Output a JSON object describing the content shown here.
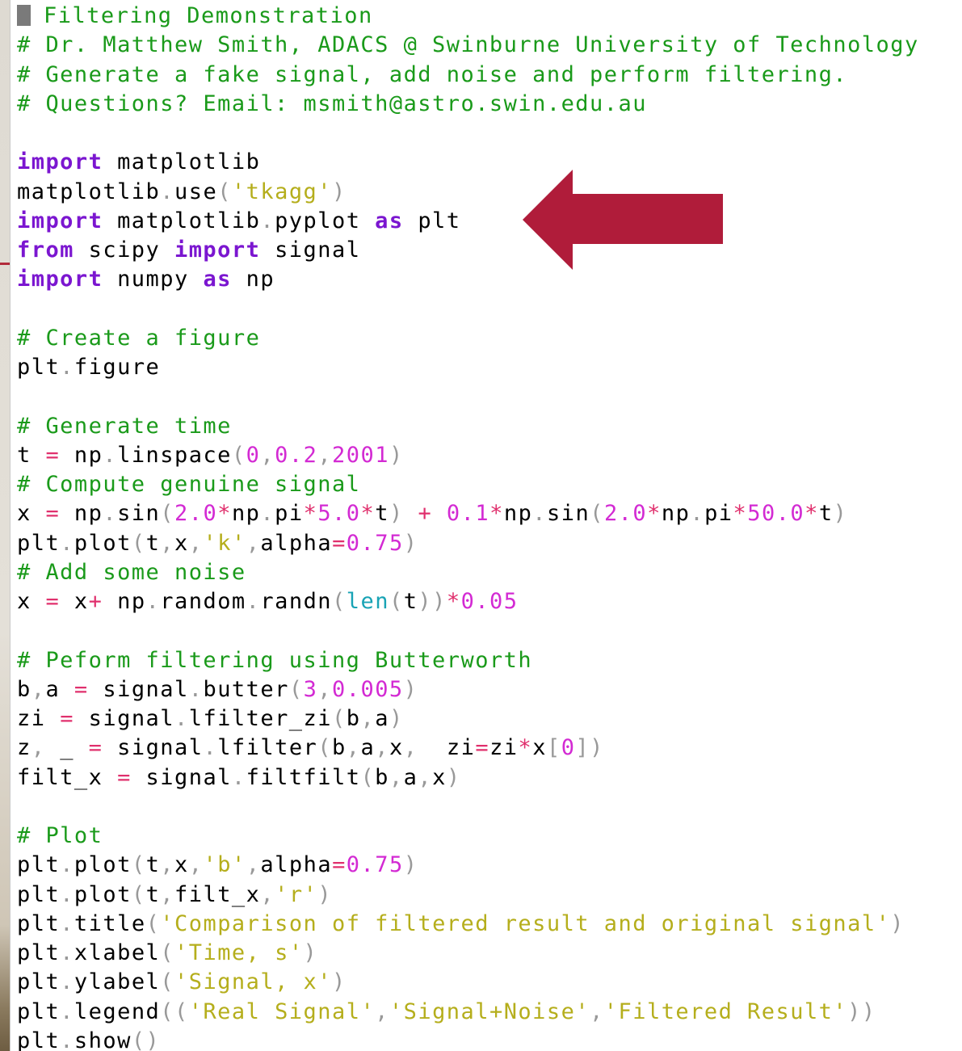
{
  "colors": {
    "comment": "#1a9a1a",
    "keyword": "#7b16d0",
    "plain": "#000000",
    "punctuation": "#999999",
    "number": "#d32ad3",
    "string": "#b5ae1c",
    "builtin": "#18a3b5",
    "operator": "#e0306d",
    "arrow": "#b01c3a",
    "cursor": "#7a7a7a"
  },
  "annotation": {
    "icon": "left-arrow-icon",
    "target_line": "import matplotlib.pyplot as plt"
  },
  "code": {
    "lines": [
      [
        {
          "t": "comment",
          "v": "Filtering Demonstration"
        }
      ],
      [
        {
          "t": "comment",
          "v": "# Dr. Matthew Smith, ADACS @ Swinburne University of Technology"
        }
      ],
      [
        {
          "t": "comment",
          "v": "# Generate a fake signal, add noise and perform filtering."
        }
      ],
      [
        {
          "t": "comment",
          "v": "# Questions? Email: msmith@astro.swin.edu.au"
        }
      ],
      [],
      [
        {
          "t": "keyword",
          "v": "import"
        },
        {
          "t": "plain",
          "v": " matplotlib"
        }
      ],
      [
        {
          "t": "plain",
          "v": "matplotlib"
        },
        {
          "t": "punct",
          "v": "."
        },
        {
          "t": "plain",
          "v": "use"
        },
        {
          "t": "punct",
          "v": "("
        },
        {
          "t": "string",
          "v": "'tkagg'"
        },
        {
          "t": "punct",
          "v": ")"
        }
      ],
      [
        {
          "t": "keyword",
          "v": "import"
        },
        {
          "t": "plain",
          "v": " matplotlib"
        },
        {
          "t": "punct",
          "v": "."
        },
        {
          "t": "plain",
          "v": "pyplot "
        },
        {
          "t": "keyword",
          "v": "as"
        },
        {
          "t": "plain",
          "v": " plt"
        }
      ],
      [
        {
          "t": "keyword",
          "v": "from"
        },
        {
          "t": "plain",
          "v": " scipy "
        },
        {
          "t": "keyword",
          "v": "import"
        },
        {
          "t": "plain",
          "v": " signal"
        }
      ],
      [
        {
          "t": "keyword",
          "v": "import"
        },
        {
          "t": "plain",
          "v": " numpy "
        },
        {
          "t": "keyword",
          "v": "as"
        },
        {
          "t": "plain",
          "v": " np"
        }
      ],
      [],
      [
        {
          "t": "comment",
          "v": "# Create a figure"
        }
      ],
      [
        {
          "t": "plain",
          "v": "plt"
        },
        {
          "t": "punct",
          "v": "."
        },
        {
          "t": "plain",
          "v": "figure"
        }
      ],
      [],
      [
        {
          "t": "comment",
          "v": "# Generate time"
        }
      ],
      [
        {
          "t": "plain",
          "v": "t "
        },
        {
          "t": "op",
          "v": "="
        },
        {
          "t": "plain",
          "v": " np"
        },
        {
          "t": "punct",
          "v": "."
        },
        {
          "t": "plain",
          "v": "linspace"
        },
        {
          "t": "punct",
          "v": "("
        },
        {
          "t": "number",
          "v": "0"
        },
        {
          "t": "punct",
          "v": ","
        },
        {
          "t": "number",
          "v": "0.2"
        },
        {
          "t": "punct",
          "v": ","
        },
        {
          "t": "number",
          "v": "2001"
        },
        {
          "t": "punct",
          "v": ")"
        }
      ],
      [
        {
          "t": "comment",
          "v": "# Compute genuine signal"
        }
      ],
      [
        {
          "t": "plain",
          "v": "x "
        },
        {
          "t": "op",
          "v": "="
        },
        {
          "t": "plain",
          "v": " np"
        },
        {
          "t": "punct",
          "v": "."
        },
        {
          "t": "plain",
          "v": "sin"
        },
        {
          "t": "punct",
          "v": "("
        },
        {
          "t": "number",
          "v": "2.0"
        },
        {
          "t": "op",
          "v": "*"
        },
        {
          "t": "plain",
          "v": "np"
        },
        {
          "t": "punct",
          "v": "."
        },
        {
          "t": "plain",
          "v": "pi"
        },
        {
          "t": "op",
          "v": "*"
        },
        {
          "t": "number",
          "v": "5.0"
        },
        {
          "t": "op",
          "v": "*"
        },
        {
          "t": "plain",
          "v": "t"
        },
        {
          "t": "punct",
          "v": ")"
        },
        {
          "t": "plain",
          "v": " "
        },
        {
          "t": "op",
          "v": "+"
        },
        {
          "t": "plain",
          "v": " "
        },
        {
          "t": "number",
          "v": "0.1"
        },
        {
          "t": "op",
          "v": "*"
        },
        {
          "t": "plain",
          "v": "np"
        },
        {
          "t": "punct",
          "v": "."
        },
        {
          "t": "plain",
          "v": "sin"
        },
        {
          "t": "punct",
          "v": "("
        },
        {
          "t": "number",
          "v": "2.0"
        },
        {
          "t": "op",
          "v": "*"
        },
        {
          "t": "plain",
          "v": "np"
        },
        {
          "t": "punct",
          "v": "."
        },
        {
          "t": "plain",
          "v": "pi"
        },
        {
          "t": "op",
          "v": "*"
        },
        {
          "t": "number",
          "v": "50.0"
        },
        {
          "t": "op",
          "v": "*"
        },
        {
          "t": "plain",
          "v": "t"
        },
        {
          "t": "punct",
          "v": ")"
        }
      ],
      [
        {
          "t": "plain",
          "v": "plt"
        },
        {
          "t": "punct",
          "v": "."
        },
        {
          "t": "plain",
          "v": "plot"
        },
        {
          "t": "punct",
          "v": "("
        },
        {
          "t": "plain",
          "v": "t"
        },
        {
          "t": "punct",
          "v": ","
        },
        {
          "t": "plain",
          "v": "x"
        },
        {
          "t": "punct",
          "v": ","
        },
        {
          "t": "string",
          "v": "'k'"
        },
        {
          "t": "punct",
          "v": ","
        },
        {
          "t": "plain",
          "v": "alpha"
        },
        {
          "t": "op",
          "v": "="
        },
        {
          "t": "number",
          "v": "0.75"
        },
        {
          "t": "punct",
          "v": ")"
        }
      ],
      [
        {
          "t": "comment",
          "v": "# Add some noise"
        }
      ],
      [
        {
          "t": "plain",
          "v": "x "
        },
        {
          "t": "op",
          "v": "="
        },
        {
          "t": "plain",
          "v": " x"
        },
        {
          "t": "op",
          "v": "+"
        },
        {
          "t": "plain",
          "v": " np"
        },
        {
          "t": "punct",
          "v": "."
        },
        {
          "t": "plain",
          "v": "random"
        },
        {
          "t": "punct",
          "v": "."
        },
        {
          "t": "plain",
          "v": "randn"
        },
        {
          "t": "punct",
          "v": "("
        },
        {
          "t": "builtin",
          "v": "len"
        },
        {
          "t": "punct",
          "v": "("
        },
        {
          "t": "plain",
          "v": "t"
        },
        {
          "t": "punct",
          "v": "))"
        },
        {
          "t": "op",
          "v": "*"
        },
        {
          "t": "number",
          "v": "0.05"
        }
      ],
      [],
      [
        {
          "t": "comment",
          "v": "# Peform filtering using Butterworth"
        }
      ],
      [
        {
          "t": "plain",
          "v": "b"
        },
        {
          "t": "punct",
          "v": ","
        },
        {
          "t": "plain",
          "v": "a "
        },
        {
          "t": "op",
          "v": "="
        },
        {
          "t": "plain",
          "v": " signal"
        },
        {
          "t": "punct",
          "v": "."
        },
        {
          "t": "plain",
          "v": "butter"
        },
        {
          "t": "punct",
          "v": "("
        },
        {
          "t": "number",
          "v": "3"
        },
        {
          "t": "punct",
          "v": ","
        },
        {
          "t": "number",
          "v": "0.005"
        },
        {
          "t": "punct",
          "v": ")"
        }
      ],
      [
        {
          "t": "plain",
          "v": "zi "
        },
        {
          "t": "op",
          "v": "="
        },
        {
          "t": "plain",
          "v": " signal"
        },
        {
          "t": "punct",
          "v": "."
        },
        {
          "t": "plain",
          "v": "lfilter_zi"
        },
        {
          "t": "punct",
          "v": "("
        },
        {
          "t": "plain",
          "v": "b"
        },
        {
          "t": "punct",
          "v": ","
        },
        {
          "t": "plain",
          "v": "a"
        },
        {
          "t": "punct",
          "v": ")"
        }
      ],
      [
        {
          "t": "plain",
          "v": "z"
        },
        {
          "t": "punct",
          "v": ","
        },
        {
          "t": "plain",
          "v": " _ "
        },
        {
          "t": "op",
          "v": "="
        },
        {
          "t": "plain",
          "v": " signal"
        },
        {
          "t": "punct",
          "v": "."
        },
        {
          "t": "plain",
          "v": "lfilter"
        },
        {
          "t": "punct",
          "v": "("
        },
        {
          "t": "plain",
          "v": "b"
        },
        {
          "t": "punct",
          "v": ","
        },
        {
          "t": "plain",
          "v": "a"
        },
        {
          "t": "punct",
          "v": ","
        },
        {
          "t": "plain",
          "v": "x"
        },
        {
          "t": "punct",
          "v": ","
        },
        {
          "t": "plain",
          "v": "  zi"
        },
        {
          "t": "op",
          "v": "="
        },
        {
          "t": "plain",
          "v": "zi"
        },
        {
          "t": "op",
          "v": "*"
        },
        {
          "t": "plain",
          "v": "x"
        },
        {
          "t": "punct",
          "v": "["
        },
        {
          "t": "number",
          "v": "0"
        },
        {
          "t": "punct",
          "v": "])"
        }
      ],
      [
        {
          "t": "plain",
          "v": "filt_x "
        },
        {
          "t": "op",
          "v": "="
        },
        {
          "t": "plain",
          "v": " signal"
        },
        {
          "t": "punct",
          "v": "."
        },
        {
          "t": "plain",
          "v": "filtfilt"
        },
        {
          "t": "punct",
          "v": "("
        },
        {
          "t": "plain",
          "v": "b"
        },
        {
          "t": "punct",
          "v": ","
        },
        {
          "t": "plain",
          "v": "a"
        },
        {
          "t": "punct",
          "v": ","
        },
        {
          "t": "plain",
          "v": "x"
        },
        {
          "t": "punct",
          "v": ")"
        }
      ],
      [],
      [
        {
          "t": "comment",
          "v": "# Plot"
        }
      ],
      [
        {
          "t": "plain",
          "v": "plt"
        },
        {
          "t": "punct",
          "v": "."
        },
        {
          "t": "plain",
          "v": "plot"
        },
        {
          "t": "punct",
          "v": "("
        },
        {
          "t": "plain",
          "v": "t"
        },
        {
          "t": "punct",
          "v": ","
        },
        {
          "t": "plain",
          "v": "x"
        },
        {
          "t": "punct",
          "v": ","
        },
        {
          "t": "string",
          "v": "'b'"
        },
        {
          "t": "punct",
          "v": ","
        },
        {
          "t": "plain",
          "v": "alpha"
        },
        {
          "t": "op",
          "v": "="
        },
        {
          "t": "number",
          "v": "0.75"
        },
        {
          "t": "punct",
          "v": ")"
        }
      ],
      [
        {
          "t": "plain",
          "v": "plt"
        },
        {
          "t": "punct",
          "v": "."
        },
        {
          "t": "plain",
          "v": "plot"
        },
        {
          "t": "punct",
          "v": "("
        },
        {
          "t": "plain",
          "v": "t"
        },
        {
          "t": "punct",
          "v": ","
        },
        {
          "t": "plain",
          "v": "filt_x"
        },
        {
          "t": "punct",
          "v": ","
        },
        {
          "t": "string",
          "v": "'r'"
        },
        {
          "t": "punct",
          "v": ")"
        }
      ],
      [
        {
          "t": "plain",
          "v": "plt"
        },
        {
          "t": "punct",
          "v": "."
        },
        {
          "t": "plain",
          "v": "title"
        },
        {
          "t": "punct",
          "v": "("
        },
        {
          "t": "string",
          "v": "'Comparison of filtered result and original signal'"
        },
        {
          "t": "punct",
          "v": ")"
        }
      ],
      [
        {
          "t": "plain",
          "v": "plt"
        },
        {
          "t": "punct",
          "v": "."
        },
        {
          "t": "plain",
          "v": "xlabel"
        },
        {
          "t": "punct",
          "v": "("
        },
        {
          "t": "string",
          "v": "'Time, s'"
        },
        {
          "t": "punct",
          "v": ")"
        }
      ],
      [
        {
          "t": "plain",
          "v": "plt"
        },
        {
          "t": "punct",
          "v": "."
        },
        {
          "t": "plain",
          "v": "ylabel"
        },
        {
          "t": "punct",
          "v": "("
        },
        {
          "t": "string",
          "v": "'Signal, x'"
        },
        {
          "t": "punct",
          "v": ")"
        }
      ],
      [
        {
          "t": "plain",
          "v": "plt"
        },
        {
          "t": "punct",
          "v": "."
        },
        {
          "t": "plain",
          "v": "legend"
        },
        {
          "t": "punct",
          "v": "(("
        },
        {
          "t": "string",
          "v": "'Real Signal'"
        },
        {
          "t": "punct",
          "v": ","
        },
        {
          "t": "string",
          "v": "'Signal+Noise'"
        },
        {
          "t": "punct",
          "v": ","
        },
        {
          "t": "string",
          "v": "'Filtered Result'"
        },
        {
          "t": "punct",
          "v": "))"
        }
      ],
      [
        {
          "t": "plain",
          "v": "plt"
        },
        {
          "t": "punct",
          "v": "."
        },
        {
          "t": "plain",
          "v": "show"
        },
        {
          "t": "punct",
          "v": "()"
        }
      ]
    ]
  }
}
